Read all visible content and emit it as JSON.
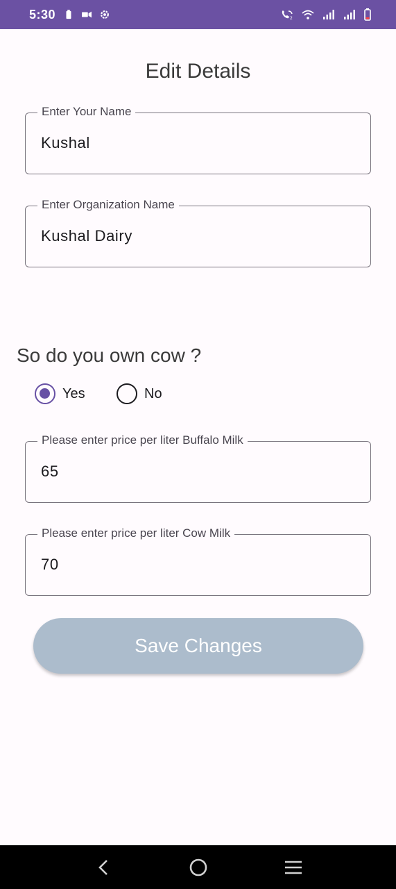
{
  "status_bar": {
    "time": "5:30",
    "icons": [
      "battery-saver-icon",
      "video-record-icon",
      "settings-icon",
      "wifi-calling-icon",
      "wifi-icon",
      "signal-icon",
      "signal-icon",
      "battery-icon"
    ]
  },
  "page": {
    "title": "Edit Details"
  },
  "form": {
    "name": {
      "label": "Enter Your Name",
      "value": "Kushal"
    },
    "organization": {
      "label": "Enter Organization Name",
      "value": "Kushal Dairy"
    },
    "question": "So do you own cow ?",
    "options": [
      {
        "label": "Yes",
        "checked": true
      },
      {
        "label": "No",
        "checked": false
      }
    ],
    "buffalo_price": {
      "label": "Please enter price per liter Buffalo Milk",
      "value": "65"
    },
    "cow_price": {
      "label": "Please enter price per liter Cow Milk",
      "value": "70"
    },
    "save_label": "Save Changes"
  },
  "nav_bar": {
    "buttons": [
      "back-icon",
      "home-icon",
      "recents-icon"
    ]
  },
  "colors": {
    "status_bar": "#6b51a3",
    "accent": "#6750a4",
    "button_disabled": "#acbccc",
    "background": "#fffbfe"
  }
}
